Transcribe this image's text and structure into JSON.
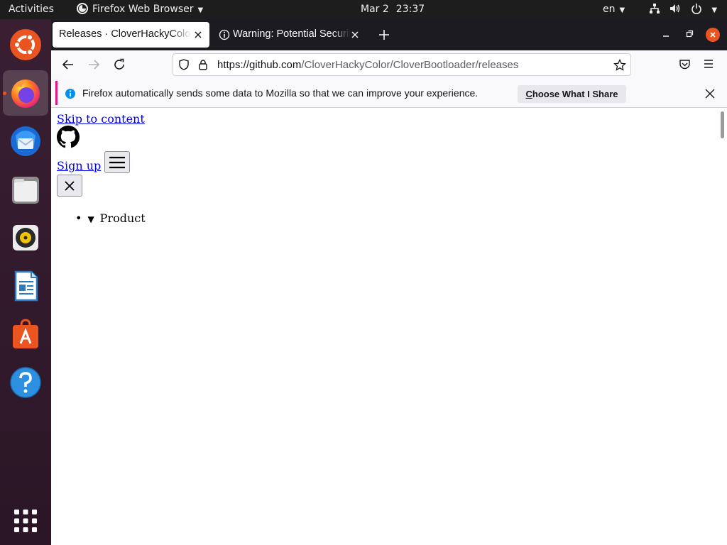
{
  "topbar": {
    "activities": "Activities",
    "app_name": "Firefox Web Browser",
    "date": "Mar 2",
    "time": "23:37",
    "language": "en",
    "icons": [
      "network-icon",
      "volume-icon",
      "power-icon"
    ]
  },
  "dock": {
    "items": [
      "ubuntu-icon",
      "firefox-icon",
      "thunderbird-icon",
      "files-icon",
      "rhythmbox-icon",
      "writer-icon",
      "software-icon",
      "help-icon",
      "app-grid-icon"
    ],
    "active": "firefox-icon",
    "accent": "#e95420"
  },
  "browser": {
    "tabs": [
      {
        "label": "Releases · CloverHackyColor/CloverBootloader",
        "active": true
      },
      {
        "label": "Warning: Potential Security Risk Ahead",
        "active": false
      }
    ],
    "url_host": "https://github.com",
    "url_path": "/CloverHackyColor/CloverBootloader/releases",
    "notification": {
      "message": "Firefox automatically sends some data to Mozilla so that we can improve your experience.",
      "button_first": "C",
      "button_rest": "hoose What I Share"
    }
  },
  "page": {
    "skip_link": "Skip to content",
    "signup_link": "Sign up",
    "nav_item": "Product",
    "link_color": "#0000ee"
  }
}
